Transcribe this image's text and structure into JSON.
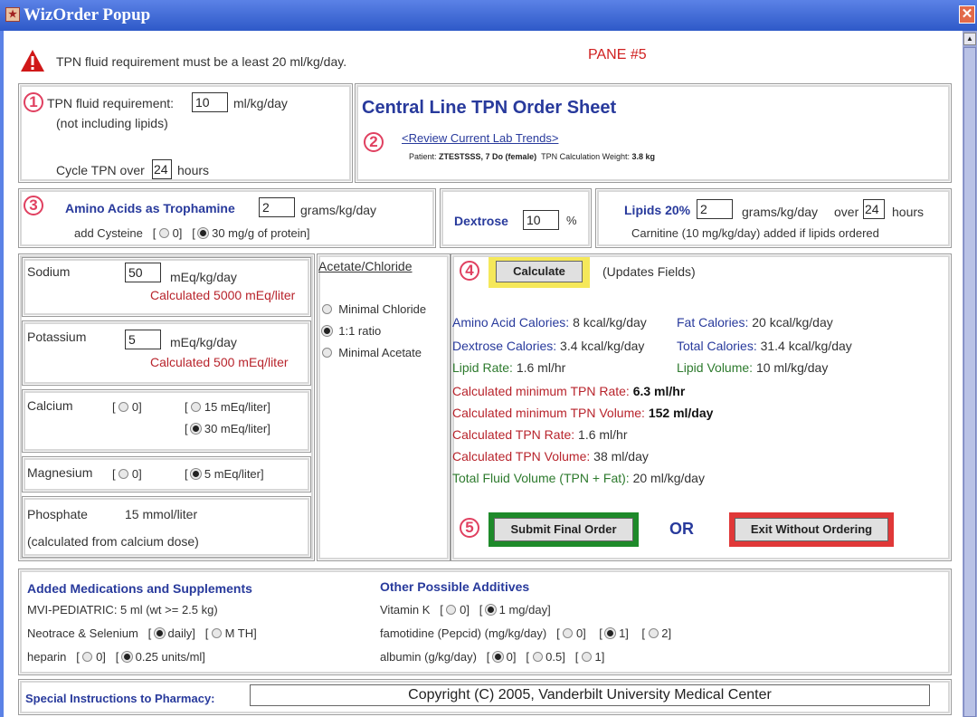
{
  "window": {
    "title": "WizOrder Popup"
  },
  "warning": {
    "text": "TPN fluid requirement must be a least 20 ml/kg/day.",
    "pane": "PANE #5"
  },
  "fluid": {
    "label": "TPN fluid requirement:",
    "value": "10",
    "unit": "ml/kg/day",
    "note": "(not including lipids)",
    "cycle_pre": "Cycle TPN over",
    "cycle_value": "24",
    "cycle_post": "hours"
  },
  "sheet": {
    "title": "Central Line TPN Order Sheet",
    "link": "<Review Current Lab Trends>",
    "patient_label": "Patient:",
    "patient": "ZTESTSSS, 7 Do (female)",
    "weight_label": "TPN Calculation Weight:",
    "weight": "3.8 kg"
  },
  "amino": {
    "label": "Amino Acids as Trophamine",
    "value": "2",
    "unit": "grams/kg/day",
    "cysteine_label": "add Cysteine",
    "opt0": "0]",
    "opt1": "30 mg/g of protein]"
  },
  "dextrose": {
    "label": "Dextrose",
    "value": "10",
    "unit": "%"
  },
  "lipids": {
    "label": "Lipids 20%",
    "value": "2",
    "unit": "grams/kg/day",
    "over": "over",
    "hours_value": "24",
    "hours": "hours",
    "carnitine": "Carnitine (10 mg/kg/day) added if lipids ordered"
  },
  "sodium": {
    "label": "Sodium",
    "value": "50",
    "unit": "mEq/kg/day",
    "calc": "Calculated 5000 mEq/liter"
  },
  "potassium": {
    "label": "Potassium",
    "value": "5",
    "unit": "mEq/kg/day",
    "calc": "Calculated 500 mEq/liter"
  },
  "calcium": {
    "label": "Calcium",
    "opt0": "0]",
    "opt1": "15 mEq/liter]",
    "opt2": "30 mEq/liter]"
  },
  "magnesium": {
    "label": "Magnesium",
    "opt0": "0]",
    "opt1": "5 mEq/liter]"
  },
  "phosphate": {
    "label": "Phosphate",
    "value": "15 mmol/liter",
    "note": "(calculated from calcium dose)"
  },
  "acetate": {
    "title": "Acetate/Chloride",
    "opts": [
      "Minimal Chloride",
      "1:1 ratio",
      "Minimal Acetate"
    ]
  },
  "calc": {
    "button": "Calculate",
    "note": "(Updates Fields)",
    "aa_cal_label": "Amino Acid Calories:",
    "aa_cal": "8 kcal/kg/day",
    "fat_cal_label": "Fat Calories:",
    "fat_cal": "20 kcal/kg/day",
    "dex_cal_label": "Dextrose Calories:",
    "dex_cal": "3.4 kcal/kg/day",
    "tot_cal_label": "Total Calories:",
    "tot_cal": "31.4 kcal/kg/day",
    "lipid_rate_label": "Lipid Rate:",
    "lipid_rate": "1.6 ml/hr",
    "lipid_vol_label": "Lipid Volume:",
    "lipid_vol": "10 ml/kg/day",
    "min_rate_label": "Calculated minimum TPN Rate:",
    "min_rate": "6.3 ml/hr",
    "min_vol_label": "Calculated minimum TPN Volume:",
    "min_vol": "152 ml/day",
    "tpn_rate_label": "Calculated TPN Rate:",
    "tpn_rate": "1.6 ml/hr",
    "tpn_vol_label": "Calculated TPN Volume:",
    "tpn_vol": "38 ml/day",
    "total_fluid_label": "Total Fluid Volume (TPN + Fat):",
    "total_fluid": "20 ml/kg/day",
    "submit": "Submit Final Order",
    "or": "OR",
    "exit": "Exit Without Ordering"
  },
  "meds": {
    "title": "Added Medications and Supplements",
    "mvi": "MVI-PEDIATRIC:   5 ml (wt >= 2.5 kg)",
    "neotrace": "Neotrace & Selenium",
    "neo_opt0": "daily]",
    "neo_opt1": "M  TH]",
    "heparin": "heparin",
    "hep_opt0": "0]",
    "hep_opt1": "0.25 units/ml]"
  },
  "additives": {
    "title": "Other Possible Additives",
    "vitk": "Vitamin K",
    "vitk_opt0": "0]",
    "vitk_opt1": "1 mg/day]",
    "famo": "famotidine (Pepcid) (mg/kg/day)",
    "famo_opt0": "0]",
    "famo_opt1": "1]",
    "famo_opt2": "2]",
    "alb": "albumin (g/kg/day)",
    "alb_opt0": "0]",
    "alb_opt1": "0.5]",
    "alb_opt2": "1]"
  },
  "special": {
    "label": "Special Instructions to Pharmacy:",
    "value": "Copyright (C) 2005, Vanderbilt University Medical Center"
  },
  "nums": [
    "1",
    "2",
    "3",
    "4",
    "5"
  ]
}
